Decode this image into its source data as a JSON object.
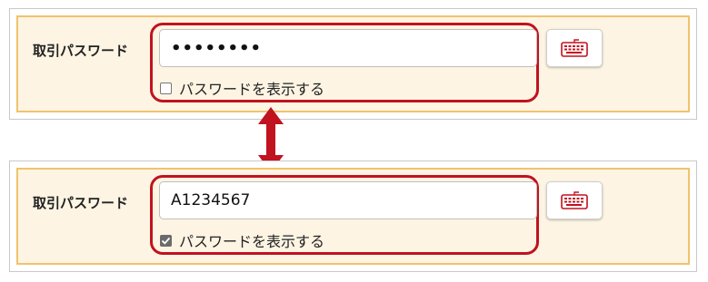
{
  "colors": {
    "highlight": "#c1121f",
    "panel_bg": "#fdf4e3",
    "panel_border": "#f0c36d",
    "arrow": "#c1121f"
  },
  "top": {
    "label": "取引パスワード",
    "password_value": "••••••••",
    "show_password_label": "パスワードを表示する",
    "show_password_checked": false,
    "keyboard_icon": "keyboard-icon"
  },
  "bottom": {
    "label": "取引パスワード",
    "password_value": "A1234567",
    "show_password_label": "パスワードを表示する",
    "show_password_checked": true,
    "keyboard_icon": "keyboard-icon"
  }
}
